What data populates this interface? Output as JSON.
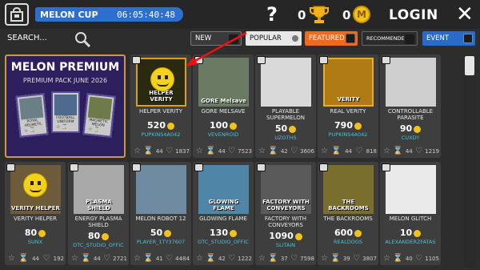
{
  "header": {
    "event_name": "MELON CUP",
    "timer": "06:05:40:48",
    "help": "?",
    "trophies": "0",
    "coins": "0",
    "coin_symbol": "M",
    "login": "LOGIN",
    "close": "✕"
  },
  "filters": {
    "search_label": "SEARCH...",
    "new": "NEW",
    "popular": "POPULAR",
    "featured": "FEATURED",
    "recommended": "RECOMMENDED",
    "event": "EVENT"
  },
  "premium": {
    "title": "MELON PREMIUM",
    "subtitle": "PREMIUM PACK JUNE 2026",
    "items": [
      {
        "label": "ROYAL HELMETS"
      },
      {
        "label": "FOOTBALL UNIFORM"
      },
      {
        "label": "MAGNETIC MELON"
      }
    ]
  },
  "items": [
    {
      "title": "HELPER VERITY",
      "price": "520",
      "author": "PUPKINS4A042",
      "likes": "44",
      "views": "1837",
      "thumb_text": "HELPER VERITY"
    },
    {
      "title": "GORE MELSAVE",
      "price": "100",
      "author": "VEVENROID",
      "likes": "44",
      "views": "7523",
      "thumb_text": "GORE Melsave"
    },
    {
      "title": "PLAYABLE SUPERMELON",
      "price": "50",
      "author": "UZOTHS",
      "likes": "42",
      "views": "3606",
      "thumb_text": ""
    },
    {
      "title": "REAL VERITY",
      "price": "790",
      "author": "PUPKINS4A042",
      "likes": "44",
      "views": "818",
      "thumb_text": "VERITY"
    },
    {
      "title": "CONTROLLABLE PARASITE",
      "price": "90",
      "author": "CUXDY",
      "likes": "44",
      "views": "1219",
      "thumb_text": ""
    },
    {
      "title": "VERITY HELPER",
      "price": "80",
      "author": "SUNX",
      "likes": "44",
      "views": "192",
      "thumb_text": "VERITY HELPER"
    },
    {
      "title": "ENERGY PLASMA SHIELD",
      "price": "80",
      "author": "OTC_STUDIO_OFFIC",
      "likes": "44",
      "views": "2721",
      "thumb_text": "PLASMA SHIELD"
    },
    {
      "title": "MELON ROBOT 12",
      "price": "50",
      "author": "PLAYER_1TY37607",
      "likes": "41",
      "views": "4484",
      "thumb_text": ""
    },
    {
      "title": "GLOWING FLAME",
      "price": "130",
      "author": "OTC_STUDIO_OFFIC",
      "likes": "42",
      "views": "1222",
      "thumb_text": "GLOWING FLAME"
    },
    {
      "title": "FACTORY WITH CONVEYORS",
      "price": "1090",
      "author": "SLITAIN",
      "likes": "37",
      "views": "7598",
      "thumb_text": "FACTORY WITH CONVEYORS"
    },
    {
      "title": "THE BACKROOMS",
      "price": "600",
      "author": "REALDOGS",
      "likes": "39",
      "views": "3807",
      "thumb_text": "THE BACKROOMS"
    },
    {
      "title": "MELON GLITCH",
      "price": "10",
      "author": "ALEXANDERZFATAS",
      "likes": "40",
      "views": "1105",
      "thumb_text": ""
    }
  ]
}
